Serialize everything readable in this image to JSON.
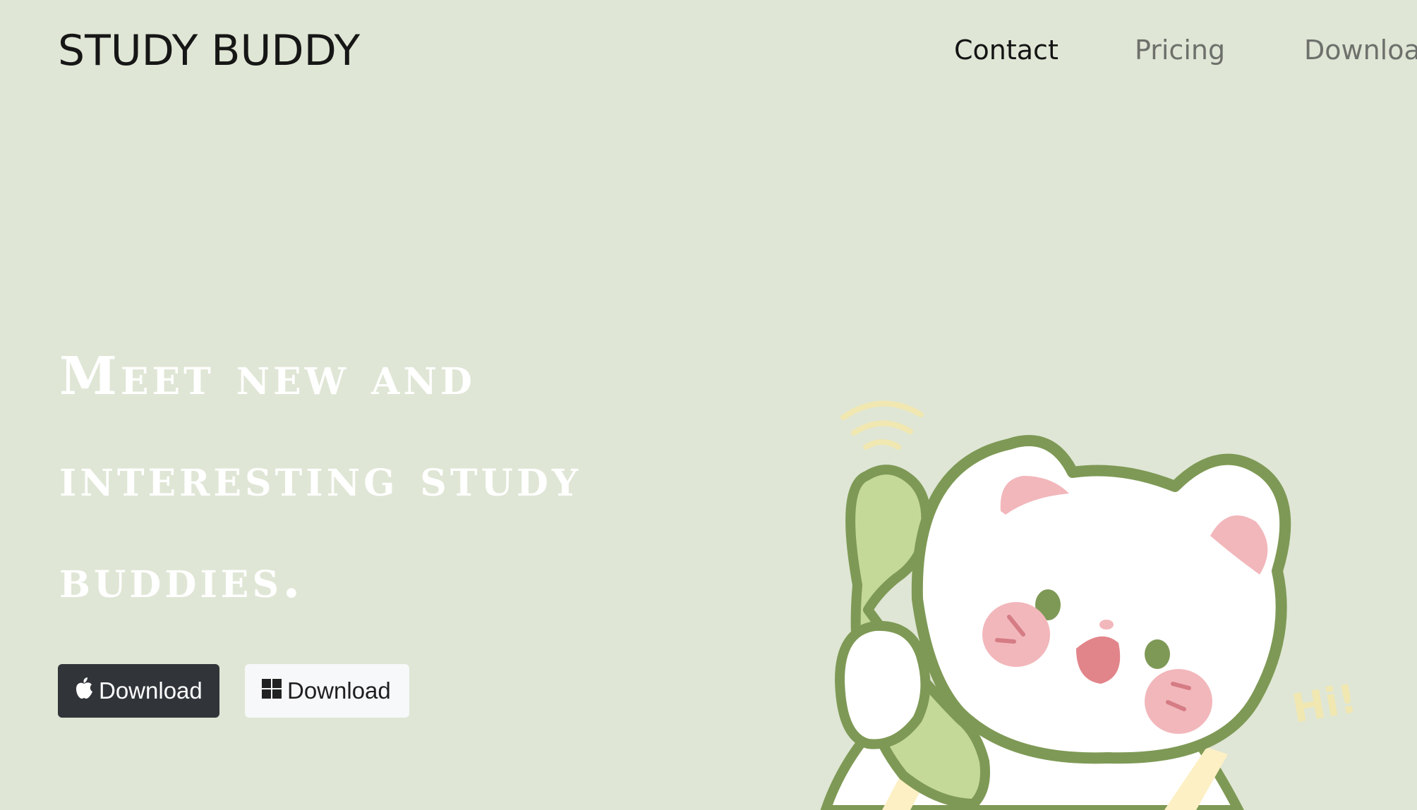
{
  "header": {
    "brand": "STUDY BUDDY",
    "nav": {
      "contact": "Contact",
      "pricing": "Pricing",
      "download": "Download"
    }
  },
  "hero": {
    "headline_lines": [
      "Meet new and",
      "interesting study",
      "buddies."
    ],
    "buttons": {
      "mac_label": "Download",
      "windows_label": "Download"
    },
    "illustration": {
      "text": "Hi!"
    }
  },
  "colors": {
    "background": "#dfe6d5",
    "headline": "#ffffff",
    "mac_button": "#31353a",
    "windows_button": "#f7f8f9",
    "bear_outline": "#7e9955",
    "phone": "#c4d897",
    "cheek": "#f2b7bb"
  },
  "icons": {
    "mac_button_icon": "apple-icon",
    "windows_button_icon": "windows-icon"
  }
}
